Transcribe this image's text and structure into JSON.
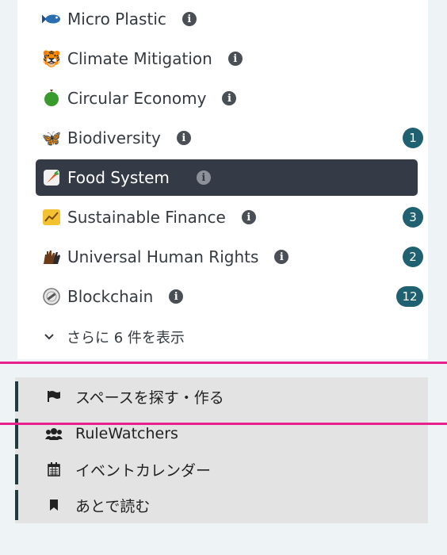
{
  "topics": [
    {
      "label": "Micro Plastic",
      "icon": "fish-icon",
      "emoji": "🐟",
      "badge": "",
      "active": false
    },
    {
      "label": "Climate Mitigation",
      "icon": "tiger-face-icon",
      "emoji": "🐯",
      "badge": "",
      "active": false
    },
    {
      "label": "Circular Economy",
      "icon": "green-circle-icon",
      "emoji": "",
      "badge": "",
      "active": false
    },
    {
      "label": "Biodiversity",
      "icon": "butterfly-icon",
      "emoji": "🦋",
      "badge": "1",
      "active": false
    },
    {
      "label": "Food System",
      "icon": "carrot-icon",
      "emoji": "🥕",
      "badge": "",
      "active": true
    },
    {
      "label": "Sustainable Finance",
      "icon": "chart-sign-icon",
      "emoji": "💹",
      "badge": "3",
      "active": false
    },
    {
      "label": "Universal Human Rights",
      "icon": "raised-hands-icon",
      "emoji": "✋",
      "badge": "2",
      "active": false
    },
    {
      "label": "Blockchain",
      "icon": "chain-link-icon",
      "emoji": "🔗",
      "badge": "12",
      "active": false
    }
  ],
  "show_more_label": "さらに 6 件を表示",
  "info_glyph": "i",
  "nav": [
    {
      "label": "スペースを探す・作る",
      "icon": "flag-icon"
    },
    {
      "label": "RuleWatchers",
      "icon": "users-icon"
    },
    {
      "label": "イベントカレンダー",
      "icon": "calendar-icon"
    },
    {
      "label": "あとで読む",
      "icon": "bookmark-icon"
    }
  ],
  "colors": {
    "active_bg": "#353a47",
    "badge_bg": "#1f6170",
    "highlight_line": "#e8208b",
    "nav_bg": "#e3e3e3",
    "nav_accent": "#1f3b3e"
  }
}
